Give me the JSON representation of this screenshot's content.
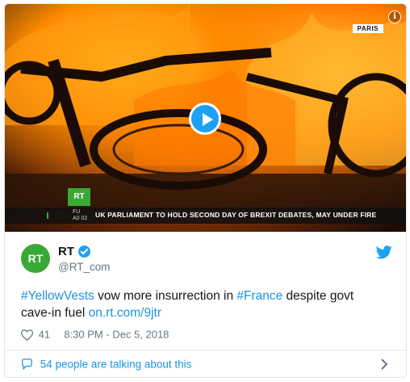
{
  "video": {
    "location": "PARIS",
    "channel_logo": "RT",
    "ticker_time": "FU\nA0 02",
    "headline": "UK PARLIAMENT TO HOLD SECOND DAY OF BREXIT DEBATES, MAY UNDER FIRE"
  },
  "author": {
    "avatar_text": "RT",
    "name": "RT",
    "handle": "@RT_com",
    "verified": true
  },
  "tweet": {
    "hashtag1": "#YellowVests",
    "text1": " vow more insurrection in ",
    "hashtag2": "#France",
    "text2": " despite govt cave-in fuel ",
    "link": "on.rt.com/9jtr"
  },
  "meta": {
    "likes": "41",
    "timestamp": "8:30 PM - Dec 5, 2018"
  },
  "footer": {
    "talking": "54 people are talking about this"
  },
  "colors": {
    "link": "#1b95e0",
    "twitter_blue": "#1da1f2",
    "rt_green": "#39a935"
  },
  "icons": [
    "info-icon",
    "play-icon",
    "verified-icon",
    "twitter-bird-icon",
    "heart-icon",
    "comment-bubble-icon",
    "chevron-right-icon"
  ]
}
